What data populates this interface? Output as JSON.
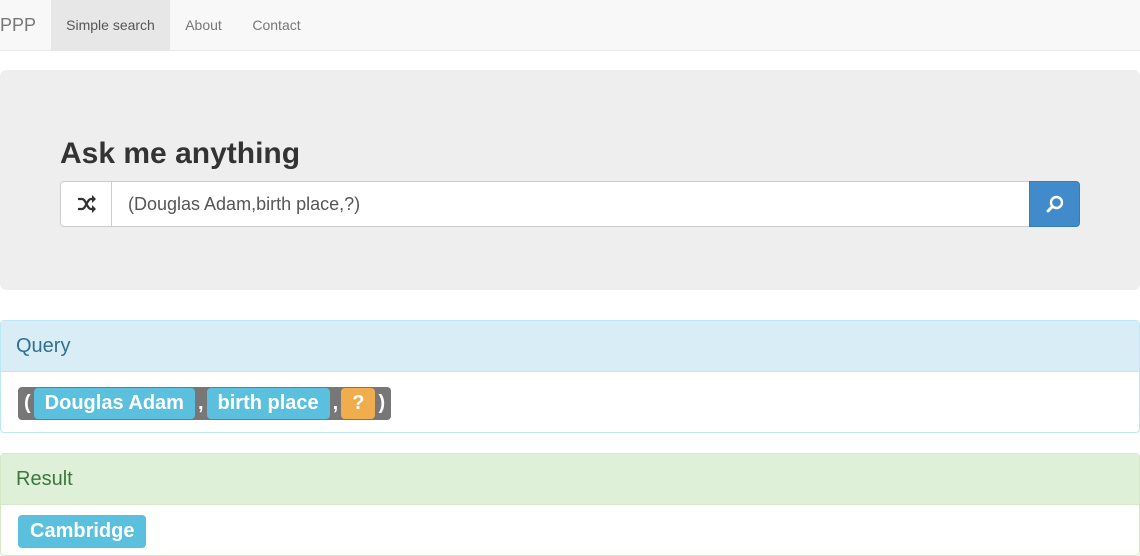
{
  "navbar": {
    "brand": "PPP",
    "items": [
      {
        "label": "Simple search",
        "active": true
      },
      {
        "label": "About",
        "active": false
      },
      {
        "label": "Contact",
        "active": false
      }
    ]
  },
  "jumbotron": {
    "title": "Ask me anything",
    "shuffle_icon": "shuffle-icon",
    "query_value": "(Douglas Adam,birth place,?)",
    "search_icon": "search-icon"
  },
  "query_panel": {
    "heading": "Query",
    "open_paren": "(",
    "subject": "Douglas Adam",
    "sep1": ",",
    "predicate": "birth place",
    "sep2": ",",
    "object": "?",
    "close_paren": ")"
  },
  "result_panel": {
    "heading": "Result",
    "value": "Cambridge"
  },
  "colors": {
    "primary": "#428bca",
    "info": "#5bc0de",
    "warning": "#f0ad4e",
    "default_label": "#777777"
  }
}
